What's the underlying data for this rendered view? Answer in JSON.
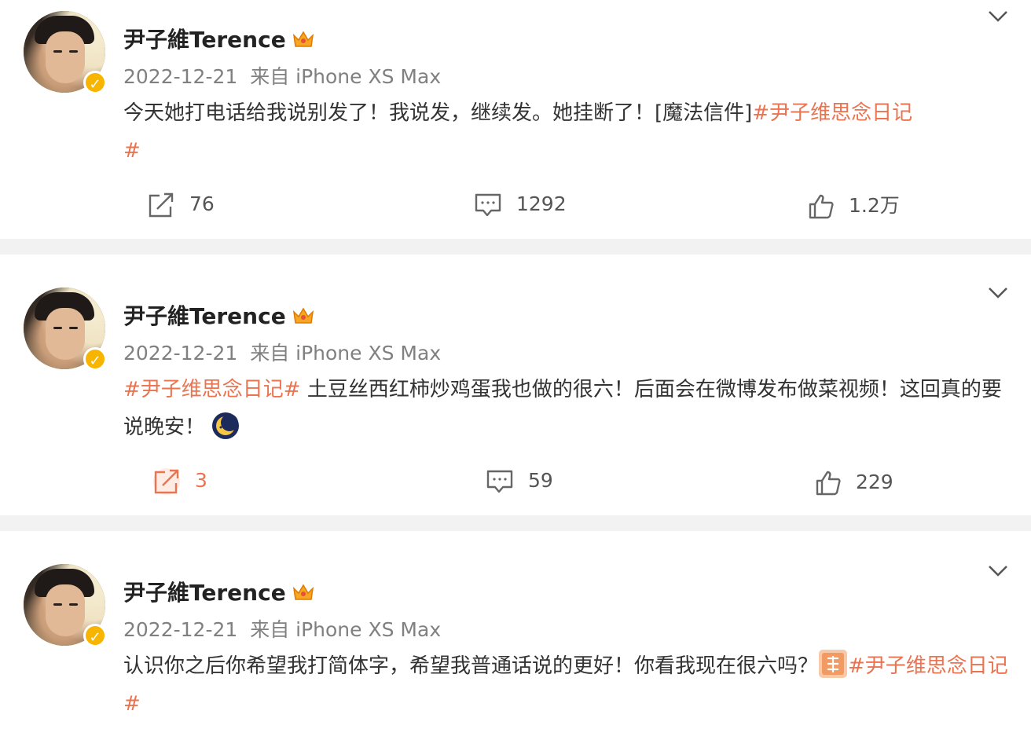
{
  "posts": [
    {
      "name": "尹子維Terence",
      "date": "2022-12-21",
      "source": "来自 iPhone XS Max",
      "text_plain": "今天她打电话给我说别发了！我说发，继续发。她挂断了！[魔法信件]",
      "tag": "#尹子维思念日记",
      "tag_wrap": "#",
      "repost": "76",
      "comment": "1292",
      "like": "1.2万"
    },
    {
      "name": "尹子維Terence",
      "date": "2022-12-21",
      "source": "来自 iPhone XS Max",
      "tag": "#尹子维思念日记#",
      "text_plain": " 土豆丝西红柿炒鸡蛋我也做的很六！后面会在微博发布做菜视频！这回真的要说晚安！",
      "emoji": "moon-emoji",
      "repost": "3",
      "comment": "59",
      "like": "229"
    },
    {
      "name": "尹子維Terence",
      "date": "2022-12-21",
      "source": "来自 iPhone XS Max",
      "text_plain": "认识你之后你希望我打简体字，希望我普通话说的更好！你看我现在很六吗？",
      "emoji": "zan-emoji",
      "tag": "#尹子维思念日记#"
    }
  ],
  "colors": {
    "accent": "#eb7350",
    "verified": "#f7b500",
    "divider": "#f2f2f2"
  }
}
